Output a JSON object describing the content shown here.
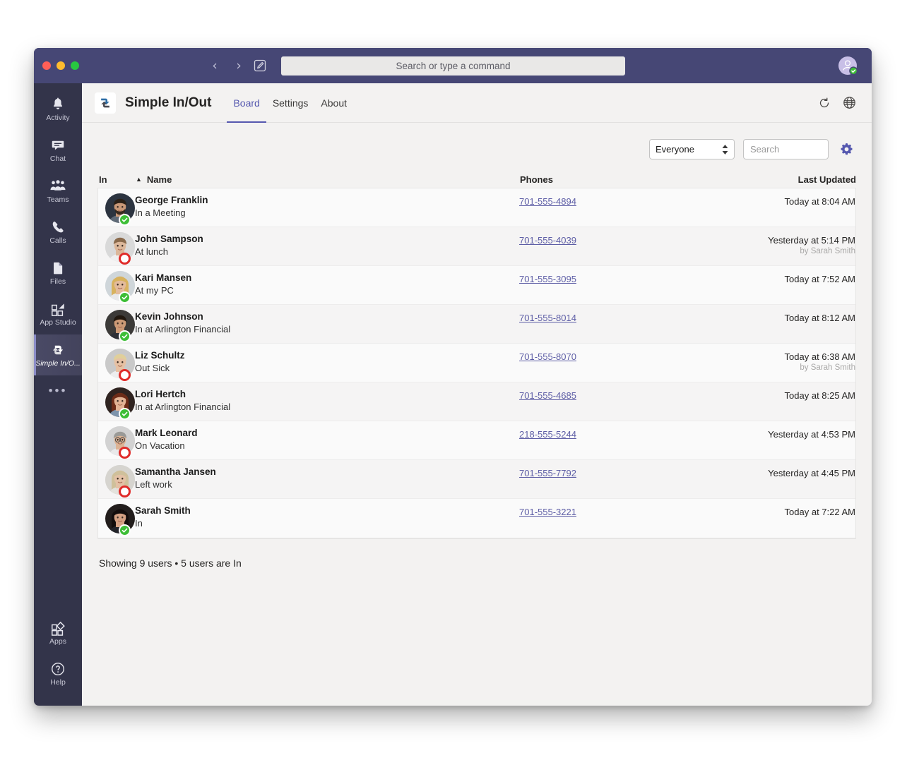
{
  "window": {
    "traffic_lights": [
      "close",
      "minimize",
      "maximize"
    ],
    "search_placeholder": "Search or type a command",
    "nav_back": "‹",
    "nav_forward": "›"
  },
  "rail": {
    "top_items": [
      {
        "label": "Activity",
        "icon": "bell-icon",
        "active": false
      },
      {
        "label": "Chat",
        "icon": "chat-icon",
        "active": false
      },
      {
        "label": "Teams",
        "icon": "teams-icon",
        "active": false
      },
      {
        "label": "Calls",
        "icon": "phone-icon",
        "active": false
      },
      {
        "label": "Files",
        "icon": "file-icon",
        "active": false
      },
      {
        "label": "App Studio",
        "icon": "app-studio-icon",
        "active": false
      },
      {
        "label": "Simple In/O...",
        "icon": "simple-in-out-icon",
        "active": true
      }
    ],
    "more": "•••",
    "bottom_items": [
      {
        "label": "Apps",
        "icon": "apps-icon"
      },
      {
        "label": "Help",
        "icon": "help-icon"
      }
    ]
  },
  "app_header": {
    "logo_icon": "simple-in-out-logo",
    "title": "Simple In/Out",
    "tabs": [
      {
        "label": "Board",
        "active": true
      },
      {
        "label": "Settings",
        "active": false
      },
      {
        "label": "About",
        "active": false
      }
    ],
    "actions": [
      {
        "icon": "refresh-icon",
        "name": "refresh-button"
      },
      {
        "icon": "globe-icon",
        "name": "open-in-browser-button"
      }
    ]
  },
  "toolbar": {
    "filter_value": "Everyone",
    "filter_options": [
      "Everyone"
    ],
    "search_placeholder": "Search",
    "search_value": "",
    "settings_icon": "gear-icon",
    "accent_color": "#5558af"
  },
  "table": {
    "columns": [
      "In",
      "Name",
      "Phones",
      "Last Updated"
    ],
    "sort_column": "Name",
    "sort_direction": "ascending",
    "sort_indicator": "▲",
    "rows": [
      {
        "name": "George Franklin",
        "status": "In a Meeting",
        "is_in": true,
        "phone": "701-555-4894",
        "updated": "Today at 8:04 AM",
        "updated_by": "",
        "avatar": "photo-male-beard-dark"
      },
      {
        "name": "John Sampson",
        "status": "At lunch",
        "is_in": false,
        "phone": "701-555-4039",
        "updated": "Yesterday at 5:14 PM",
        "updated_by": "by Sarah Smith",
        "avatar": "photo-male-short-light"
      },
      {
        "name": "Kari Mansen",
        "status": "At my PC",
        "is_in": true,
        "phone": "701-555-3095",
        "updated": "Today at 7:52 AM",
        "updated_by": "",
        "avatar": "photo-female-blonde"
      },
      {
        "name": "Kevin Johnson",
        "status": "In at Arlington Financial",
        "is_in": true,
        "phone": "701-555-8014",
        "updated": "Today at 8:12 AM",
        "updated_by": "",
        "avatar": "photo-male-dark-suit"
      },
      {
        "name": "Liz Schultz",
        "status": "Out Sick",
        "is_in": false,
        "phone": "701-555-8070",
        "updated": "Today at 6:38 AM",
        "updated_by": "by Sarah Smith",
        "avatar": "photo-female-short-blonde"
      },
      {
        "name": "Lori Hertch",
        "status": "In at Arlington Financial",
        "is_in": true,
        "phone": "701-555-4685",
        "updated": "Today at 8:25 AM",
        "updated_by": "",
        "avatar": "photo-female-auburn"
      },
      {
        "name": "Mark Leonard",
        "status": "On Vacation",
        "is_in": false,
        "phone": "218-555-5244",
        "updated": "Yesterday at 4:53 PM",
        "updated_by": "",
        "avatar": "photo-male-glasses-grey"
      },
      {
        "name": "Samantha Jansen",
        "status": "Left work",
        "is_in": false,
        "phone": "701-555-7792",
        "updated": "Yesterday at 4:45 PM",
        "updated_by": "",
        "avatar": "photo-female-blonde-light"
      },
      {
        "name": "Sarah Smith",
        "status": "In",
        "is_in": true,
        "phone": "701-555-3221",
        "updated": "Today at 7:22 AM",
        "updated_by": "",
        "avatar": "photo-female-dark-hair"
      }
    ]
  },
  "footer": {
    "summary": "Showing 9 users • 5 users are In"
  },
  "colors": {
    "teams_purple": "#464775",
    "rail_dark": "#33344a",
    "accent": "#5558af",
    "link": "#5e5ea6",
    "status_in": "#3dbe36",
    "status_out": "#e02b29",
    "content_bg": "#f3f2f1"
  }
}
